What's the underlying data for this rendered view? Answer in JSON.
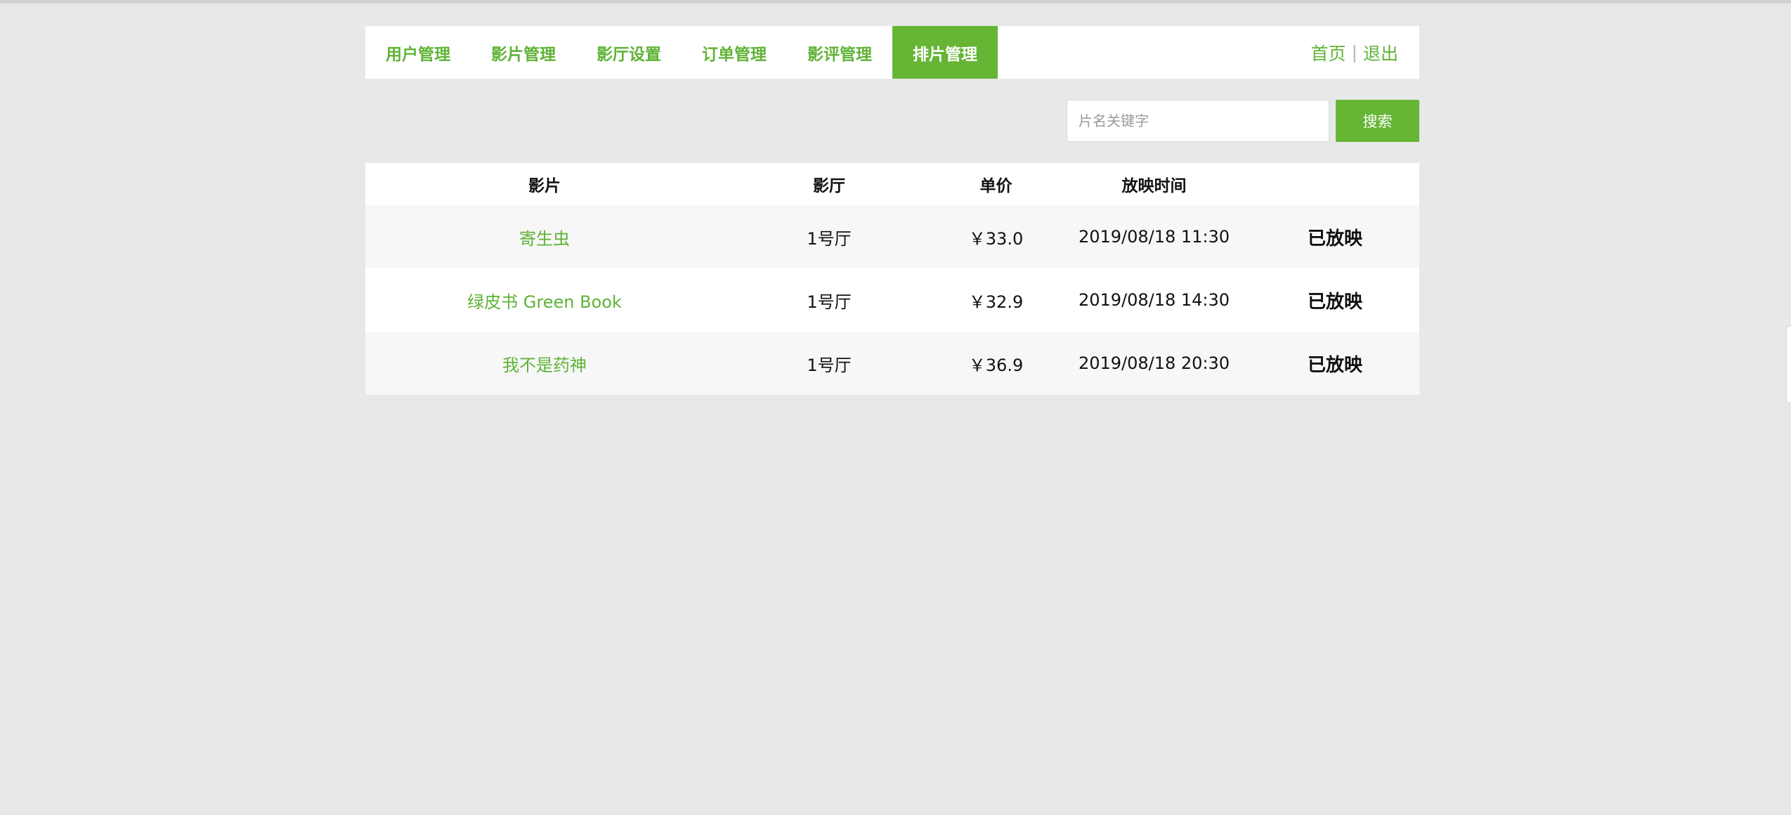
{
  "nav": {
    "tabs": [
      {
        "label": "用户管理",
        "active": false
      },
      {
        "label": "影片管理",
        "active": false
      },
      {
        "label": "影厅设置",
        "active": false
      },
      {
        "label": "订单管理",
        "active": false
      },
      {
        "label": "影评管理",
        "active": false
      },
      {
        "label": "排片管理",
        "active": true
      }
    ],
    "home_label": "首页",
    "separator": "|",
    "logout_label": "退出"
  },
  "search": {
    "placeholder": "片名关键字",
    "value": "",
    "button_label": "搜索"
  },
  "table": {
    "columns": [
      "影片",
      "影厅",
      "单价",
      "放映时间",
      ""
    ],
    "rows": [
      {
        "film": "寄生虫",
        "hall": "1号厅",
        "price": "￥33.0",
        "time": "2019/08/18 11:30",
        "status": "已放映"
      },
      {
        "film": "绿皮书 Green Book",
        "hall": "1号厅",
        "price": "￥32.9",
        "time": "2019/08/18 14:30",
        "status": "已放映"
      },
      {
        "film": "我不是药神",
        "hall": "1号厅",
        "price": "￥36.9",
        "time": "2019/08/18 20:30",
        "status": "已放映"
      }
    ]
  },
  "colors": {
    "accent": "#66b535",
    "link": "#5fb336",
    "background": "#e8e8e8"
  }
}
